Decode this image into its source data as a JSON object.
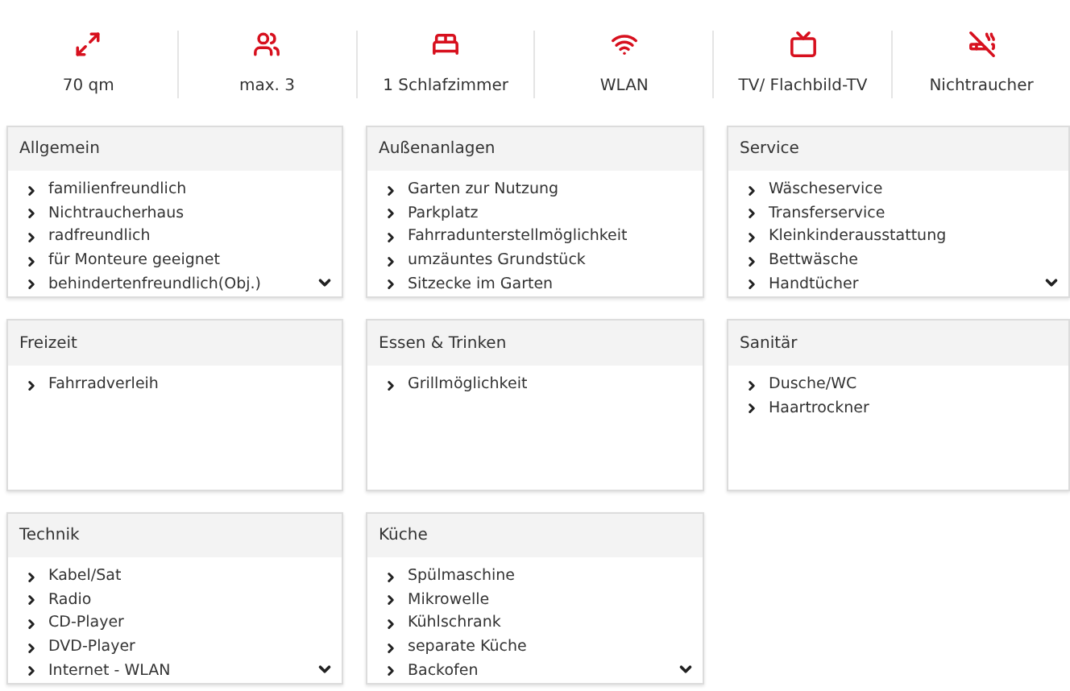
{
  "features": [
    {
      "label": "70 qm"
    },
    {
      "label": "max. 3"
    },
    {
      "label": "1 Schlafzimmer"
    },
    {
      "label": "WLAN"
    },
    {
      "label": "TV/ Flachbild-TV"
    },
    {
      "label": "Nichtraucher"
    }
  ],
  "cards": [
    {
      "title": "Allgemein",
      "items": [
        "familienfreundlich",
        "Nichtraucherhaus",
        "radfreundlich",
        "für Monteure geeignet",
        "behindertenfreundlich(Obj.)"
      ],
      "expandable": true
    },
    {
      "title": "Außenanlagen",
      "items": [
        "Garten zur Nutzung",
        "Parkplatz",
        "Fahrradunterstellmöglichkeit",
        "umzäuntes Grundstück",
        "Sitzecke im Garten"
      ],
      "expandable": false
    },
    {
      "title": "Service",
      "items": [
        "Wäscheservice",
        "Transferservice",
        "Kleinkinderausstattung",
        "Bettwäsche",
        "Handtücher"
      ],
      "expandable": true
    },
    {
      "title": "Freizeit",
      "items": [
        "Fahrradverleih"
      ],
      "expandable": false
    },
    {
      "title": "Essen & Trinken",
      "items": [
        "Grillmöglichkeit"
      ],
      "expandable": false
    },
    {
      "title": "Sanitär",
      "items": [
        "Dusche/WC",
        "Haartrockner"
      ],
      "expandable": false
    },
    {
      "title": "Technik",
      "items": [
        "Kabel/Sat",
        "Radio",
        "CD-Player",
        "DVD-Player",
        "Internet - WLAN"
      ],
      "expandable": true
    },
    {
      "title": "Küche",
      "items": [
        "Spülmaschine",
        "Mikrowelle",
        "Kühlschrank",
        "separate Küche",
        "Backofen"
      ],
      "expandable": true
    }
  ]
}
